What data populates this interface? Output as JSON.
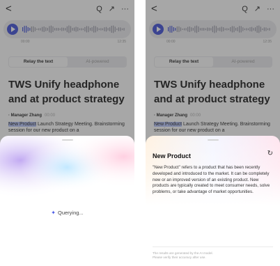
{
  "topbar": {
    "back_icon": "<",
    "search_icon": "Q",
    "share_icon": "↗",
    "more_icon": "···"
  },
  "player": {
    "start_time": "00:00",
    "end_time": "12:35"
  },
  "tabs": [
    {
      "label": "Relay the text",
      "active": true
    },
    {
      "label": "AI-powered",
      "active": false
    }
  ],
  "document": {
    "title": "TWS Unify headphone and at product strategy",
    "speaker": "· Manager Zhang",
    "speaker_time": "00:00",
    "highlight": "New Product",
    "transcript_rest": " Launch Strategy Meeting. Brainstorming session for our new product on a"
  },
  "sheet_left": {
    "status": "Querying..."
  },
  "sheet_right": {
    "term": "New Product",
    "definition": "\"New Product\" refers to a product that has been recently developed and introduced to the market. It can be completely new or an improved version of an existing product. New products are typically created to meet consumer needs, solve problems, or take advantage of market opportunities.",
    "disclaimer_line1": "The results are generated by the AI model.",
    "disclaimer_line2": "Please verify their accuracy after use."
  },
  "colors": {
    "accent": "#3b4bd8",
    "highlight": "#b8c6ff",
    "overlay": "rgba(60,60,60,0.45)"
  }
}
